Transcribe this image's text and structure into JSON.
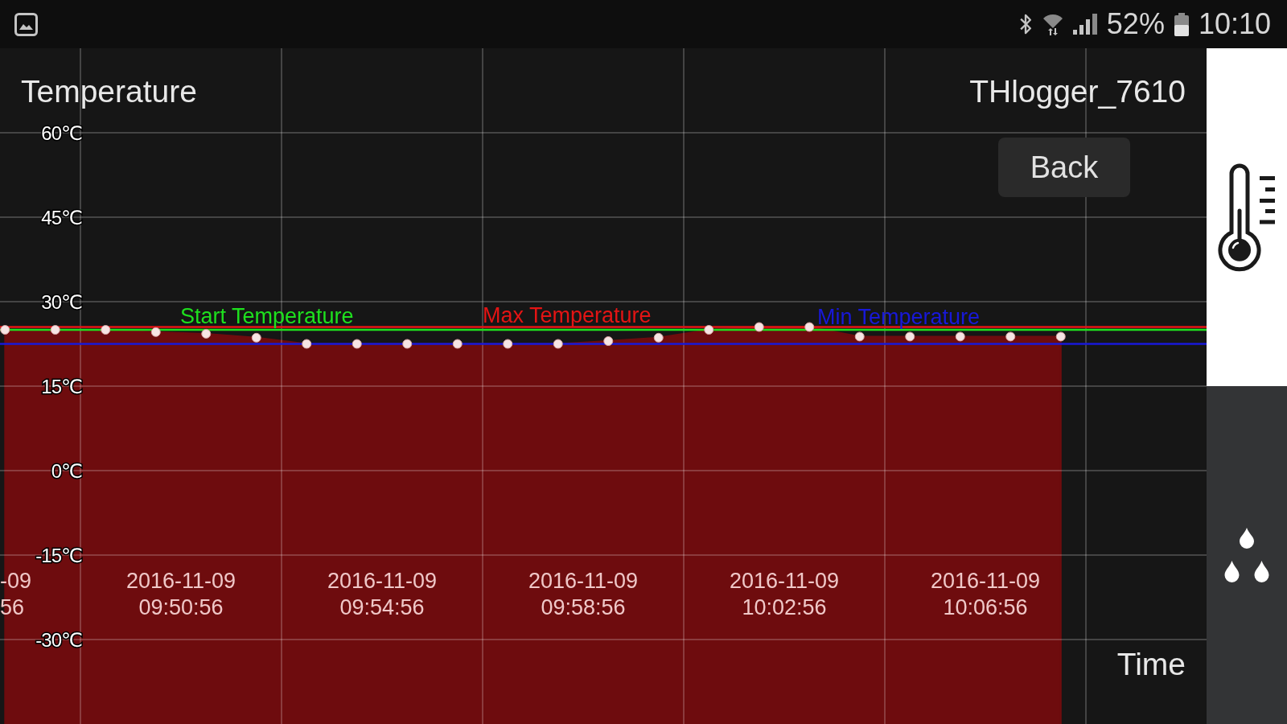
{
  "status_bar": {
    "battery": "52%",
    "time": "10:10"
  },
  "header": {
    "device_name": "THlogger_7610",
    "back_button": "Back"
  },
  "chart": {
    "chart_data": {
      "type": "area",
      "ylabel": "Temperature",
      "xlabel": "Time",
      "x": [
        "2016-11-09T09:47:26",
        "2016-11-09T09:48:26",
        "2016-11-09T09:49:26",
        "2016-11-09T09:50:26",
        "2016-11-09T09:51:26",
        "2016-11-09T09:52:26",
        "2016-11-09T09:53:26",
        "2016-11-09T09:54:26",
        "2016-11-09T09:55:26",
        "2016-11-09T09:56:26",
        "2016-11-09T09:57:26",
        "2016-11-09T09:58:26",
        "2016-11-09T09:59:26",
        "2016-11-09T10:00:26",
        "2016-11-09T10:01:26",
        "2016-11-09T10:02:26",
        "2016-11-09T10:03:26",
        "2016-11-09T10:04:26",
        "2016-11-09T10:05:26",
        "2016-11-09T10:06:26",
        "2016-11-09T10:07:26",
        "2016-11-09T10:08:26"
      ],
      "values": [
        25,
        25,
        25,
        24.6,
        24.3,
        23.6,
        22.5,
        22.5,
        22.5,
        22.5,
        22.5,
        22.5,
        23,
        23.6,
        25,
        25.5,
        25.5,
        23.8,
        23.8,
        23.8,
        23.8,
        23.8
      ],
      "color": "#6e0c0e",
      "marker": "circle",
      "grid": true,
      "xlim": [
        "2016-11-09T09:47:20",
        "2016-11-09T10:11:20"
      ],
      "ylim": [
        -45,
        75
      ],
      "xticks": [
        {
          "value": "2016-11-09T09:50:56",
          "label": "2016-11-09\n09:50:56"
        },
        {
          "value": "2016-11-09T09:54:56",
          "label": "2016-11-09\n09:54:56"
        },
        {
          "value": "2016-11-09T09:58:56",
          "label": "2016-11-09\n09:58:56"
        },
        {
          "value": "2016-11-09T10:02:56",
          "label": "2016-11-09\n10:02:56"
        },
        {
          "value": "2016-11-09T10:06:56",
          "label": "2016-11-09\n10:06:56"
        }
      ],
      "yticks": [
        {
          "value": 60,
          "label": "60℃"
        },
        {
          "value": 45,
          "label": "45℃"
        },
        {
          "value": 30,
          "label": "30℃"
        },
        {
          "value": 15,
          "label": "15℃"
        },
        {
          "value": 0,
          "label": "0℃"
        },
        {
          "value": -15,
          "label": "-15℃"
        },
        {
          "value": -30,
          "label": "-30℃"
        }
      ],
      "ref_lines": [
        {
          "axis": "y",
          "value": 25,
          "label": "Start Temperature",
          "color": "#1ee01e"
        },
        {
          "axis": "y",
          "value": 25.5,
          "label": "Max Temperature",
          "color": "#e41414"
        },
        {
          "axis": "y",
          "value": 22.5,
          "label": "Min Temperature",
          "color": "#1818d8"
        }
      ],
      "annotations": [
        "-09\n56"
      ]
    }
  },
  "sidebar": {
    "tabs": [
      {
        "kind": "temperature",
        "selected": true
      },
      {
        "kind": "humidity",
        "selected": false
      }
    ]
  }
}
